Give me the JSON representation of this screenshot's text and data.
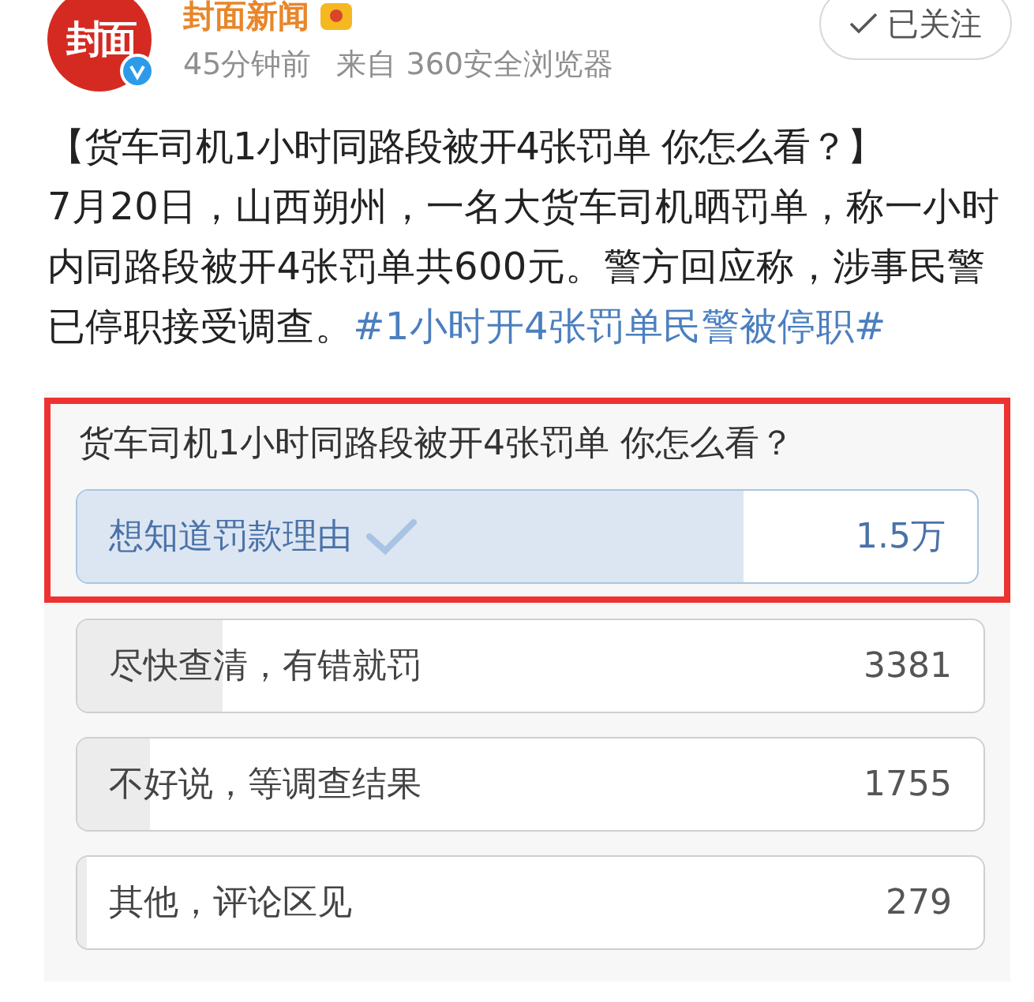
{
  "account": {
    "logo": "封面",
    "name": "封面新闻",
    "verified": true,
    "time": "45分钟前",
    "source": "来自 360安全浏览器",
    "follow": {
      "label": "已关注",
      "following": true
    }
  },
  "post": {
    "headline": "【货车司机1小时同路段被开4张罚单 你怎么看？】",
    "body": "7月20日，山西朔州，一名大货车司机晒罚单，称一小时内同路段被开4张罚单共600元。警方回应称，涉事民警已停职接受调查。",
    "hashtag": "#1小时开4张罚单民警被停职#"
  },
  "poll": {
    "question": "货车司机1小时同路段被开4张罚单 你怎么看？",
    "highlighted": true,
    "options": [
      {
        "label": "想知道罚款理由",
        "count": "1.5万",
        "level": 0.74,
        "selected": true
      },
      {
        "label": "尽快查清，有错就罚",
        "count": "3381",
        "level": 0.16,
        "selected": false
      },
      {
        "label": "不好说，等调查结果",
        "count": "1755",
        "level": 0.08,
        "selected": false
      },
      {
        "label": "其他，评论区见",
        "count": "279",
        "level": 0.01,
        "selected": false
      }
    ]
  }
}
